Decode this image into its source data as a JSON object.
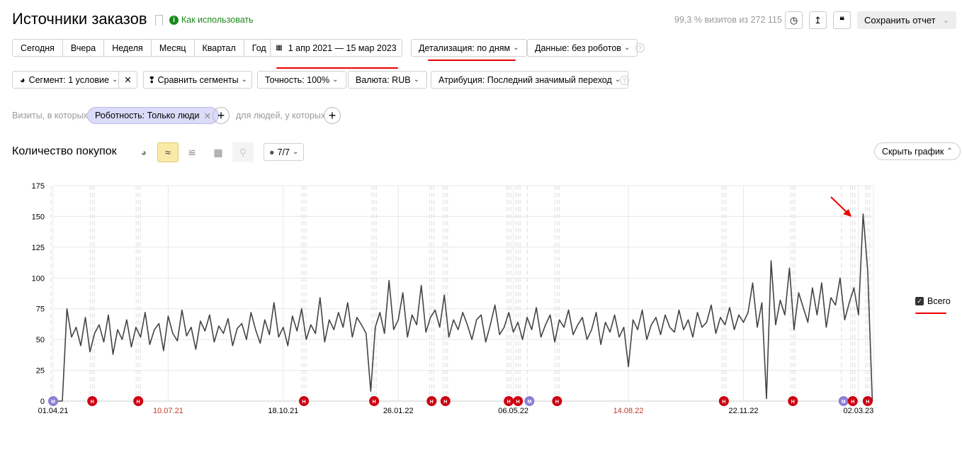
{
  "header": {
    "title": "Источники заказов",
    "how_to": "Как использовать",
    "visits_info": "99,3 % визитов из 272 115",
    "save_label": "Сохранить отчет"
  },
  "periods": [
    "Сегодня",
    "Вчера",
    "Неделя",
    "Месяц",
    "Квартал",
    "Год"
  ],
  "filters": {
    "date_range": "1 апр 2021 — 15 мар 2023",
    "detail": "Детализация: по дням",
    "data": "Данные: без роботов",
    "segment": "Сегмент: 1 условие",
    "compare": "Сравнить сегменты",
    "accuracy": "Точность: 100%",
    "currency": "Валюта: RUB",
    "attribution": "Атрибуция: Последний значимый переход"
  },
  "conditions": {
    "visits_label": "Визиты, в которых",
    "chip": "Роботность: Только люди",
    "people_label": "для людей, у которых"
  },
  "chart_header": {
    "title": "Количество покупок",
    "notes": "7/7",
    "hide": "Скрыть график"
  },
  "colors": {
    "line": "#444444",
    "marker_red": "#cc0011",
    "marker_purple": "#8c7fd6",
    "accent": "#fbe9a8"
  },
  "chart_data": {
    "type": "line",
    "title": "Количество покупок",
    "xlabel": "",
    "ylabel": "",
    "start_date": "2021-04-01",
    "step_days": 4,
    "ylim": [
      0,
      175
    ],
    "yticks": [
      "0",
      "25",
      "50",
      "75",
      "100",
      "125",
      "150",
      "175"
    ],
    "xticks": [
      {
        "label": "01.04.21",
        "date": "2021-04-01",
        "red": false
      },
      {
        "label": "10.07.21",
        "date": "2021-07-10",
        "red": true
      },
      {
        "label": "18.10.21",
        "date": "2021-10-18",
        "red": false
      },
      {
        "label": "26.01.22",
        "date": "2022-01-26",
        "red": false
      },
      {
        "label": "06.05.22",
        "date": "2022-05-06",
        "red": false
      },
      {
        "label": "14.08.22",
        "date": "2022-08-14",
        "red": true
      },
      {
        "label": "22.11.22",
        "date": "2022-11-22",
        "red": false
      },
      {
        "label": "02.03.23",
        "date": "2023-03-02",
        "red": false
      }
    ],
    "end_date": "2023-03-15",
    "series": [
      {
        "name": "Всего",
        "values": [
          0,
          0,
          0,
          75,
          52,
          60,
          45,
          68,
          40,
          55,
          62,
          48,
          70,
          38,
          58,
          50,
          66,
          44,
          60,
          52,
          72,
          46,
          58,
          63,
          41,
          69,
          55,
          49,
          74,
          53,
          60,
          42,
          65,
          57,
          70,
          48,
          61,
          55,
          67,
          45,
          59,
          63,
          50,
          72,
          58,
          47,
          66,
          54,
          80,
          52,
          60,
          45,
          69,
          57,
          75,
          50,
          62,
          55,
          84,
          48,
          66,
          58,
          72,
          60,
          80,
          52,
          68,
          62,
          55,
          8,
          60,
          72,
          55,
          98,
          58,
          66,
          88,
          52,
          70,
          62,
          94,
          56,
          68,
          74,
          60,
          86,
          52,
          66,
          58,
          72,
          62,
          50,
          66,
          70,
          48,
          62,
          78,
          54,
          60,
          72,
          56,
          64,
          50,
          68,
          58,
          76,
          52,
          62,
          70,
          48,
          66,
          60,
          74,
          54,
          62,
          68,
          50,
          58,
          72,
          46,
          64,
          56,
          70,
          52,
          60,
          28,
          66,
          58,
          74,
          50,
          62,
          68,
          54,
          70,
          60,
          56,
          74,
          58,
          66,
          52,
          72,
          60,
          64,
          78,
          55,
          68,
          62,
          76,
          58,
          70,
          64,
          72,
          96,
          60,
          80,
          2,
          114,
          62,
          82,
          70,
          108,
          58,
          88,
          76,
          64,
          92,
          70,
          96,
          60,
          84,
          78,
          100,
          66,
          80,
          92,
          70,
          152,
          106,
          0
        ]
      }
    ],
    "legend": "right",
    "markers": [
      {
        "label": "М",
        "date": "2021-04-01",
        "kind": "purple"
      },
      {
        "label": "Н",
        "date": "2021-05-05",
        "kind": "red"
      },
      {
        "label": "Н",
        "date": "2021-06-14",
        "kind": "red"
      },
      {
        "label": "Н",
        "date": "2021-11-05",
        "kind": "red"
      },
      {
        "label": "Н",
        "date": "2022-01-05",
        "kind": "red"
      },
      {
        "label": "Н",
        "date": "2022-02-24",
        "kind": "red"
      },
      {
        "label": "Н",
        "date": "2022-03-08",
        "kind": "red"
      },
      {
        "label": "Н",
        "date": "2022-05-02",
        "kind": "red"
      },
      {
        "label": "Н",
        "date": "2022-05-10",
        "kind": "red"
      },
      {
        "label": "М",
        "date": "2022-05-20",
        "kind": "purple"
      },
      {
        "label": "Н",
        "date": "2022-06-13",
        "kind": "red"
      },
      {
        "label": "Н",
        "date": "2022-11-05",
        "kind": "red"
      },
      {
        "label": "Н",
        "date": "2023-01-04",
        "kind": "red"
      },
      {
        "label": "М",
        "date": "2023-02-17",
        "kind": "purple"
      },
      {
        "label": "Н",
        "date": "2023-02-25",
        "kind": "red"
      },
      {
        "label": "Н",
        "date": "2023-03-10",
        "kind": "red"
      }
    ]
  }
}
